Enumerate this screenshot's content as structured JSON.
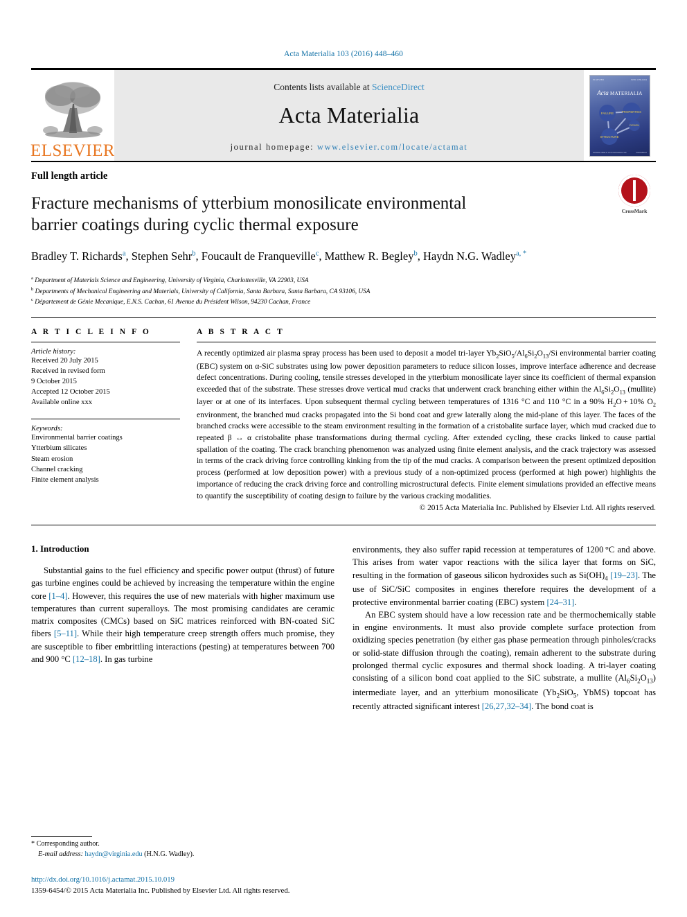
{
  "running_head": "Acta Materialia 103 (2016) 448–460",
  "masthead": {
    "publisher_name": "ELSEVIER",
    "contents_prefix": "Contents lists available at ",
    "contents_link": "ScienceDirect",
    "journal_name": "Acta Materialia",
    "homepage_prefix": "journal homepage: ",
    "homepage_url": "www.elsevier.com/locate/actamat",
    "cover": {
      "title_italic": "Acta",
      "title_caps": "MATERIALIA",
      "corner_left": "ELSEVIER",
      "corner_right": "ISSN 1359-6454",
      "footer_left": "Available online at www.sciencedirect.com",
      "footer_right": "ScienceDirect",
      "nodes": [
        "FAILURE",
        "PROPERTIES",
        "DESIGN",
        "STRUCTURE"
      ]
    }
  },
  "article": {
    "type": "Full length article",
    "title": "Fracture mechanisms of ytterbium monosilicate environmental barrier coatings during cyclic thermal exposure",
    "authors_line1": "Bradley T. Richards ",
    "authors": [
      {
        "name": "Bradley T. Richards",
        "sup": "a"
      },
      {
        "name": "Stephen Sehr",
        "sup": "b"
      },
      {
        "name": "Foucault de Franqueville",
        "sup": "c"
      },
      {
        "name": "Matthew R. Begley",
        "sup": "b"
      },
      {
        "name": "Haydn N.G. Wadley",
        "sup": "a, *"
      }
    ],
    "affiliations": [
      {
        "mark": "a",
        "text": "Department of Materials Science and Engineering, University of Virginia, Charlottesville, VA 22903, USA"
      },
      {
        "mark": "b",
        "text": "Departments of Mechanical Engineering and Materials, University of California, Santa Barbara, Santa Barbara, CA 93106, USA"
      },
      {
        "mark": "c",
        "text": "Département de Génie Mecanique, E.N.S. Cachan, 61 Avenue du Président Wilson, 94230 Cachan, France"
      }
    ],
    "crossmark_label": "CrossMark"
  },
  "info": {
    "section_label": "A R T I C L E   I N F O",
    "history_title": "Article history:",
    "history": [
      "Received 20 July 2015",
      "Received in revised form",
      "9 October 2015",
      "Accepted 12 October 2015",
      "Available online xxx"
    ],
    "keywords_title": "Keywords:",
    "keywords": [
      "Environmental barrier coatings",
      "Ytterbium silicates",
      "Steam erosion",
      "Channel cracking",
      "Finite element analysis"
    ]
  },
  "abstract": {
    "section_label": "A B S T R A C T",
    "copyright": "© 2015 Acta Materialia Inc. Published by Elsevier Ltd. All rights reserved."
  },
  "intro": {
    "heading": "1. Introduction"
  },
  "footnote": {
    "corresponding": "* Corresponding author.",
    "email_label": "E-mail address: ",
    "email": "haydn@virginia.edu",
    "email_suffix": " (H.N.G. Wadley)."
  },
  "footer": {
    "doi": "http://dx.doi.org/10.1016/j.actamat.2015.10.019",
    "issn_line": "1359-6454/© 2015 Acta Materialia Inc. Published by Elsevier Ltd. All rights reserved."
  },
  "colors": {
    "link": "#1170a6",
    "elsevier_orange": "#E87722",
    "crossmark_red": "#b4121b",
    "band_gray": "#e9e9e9"
  }
}
